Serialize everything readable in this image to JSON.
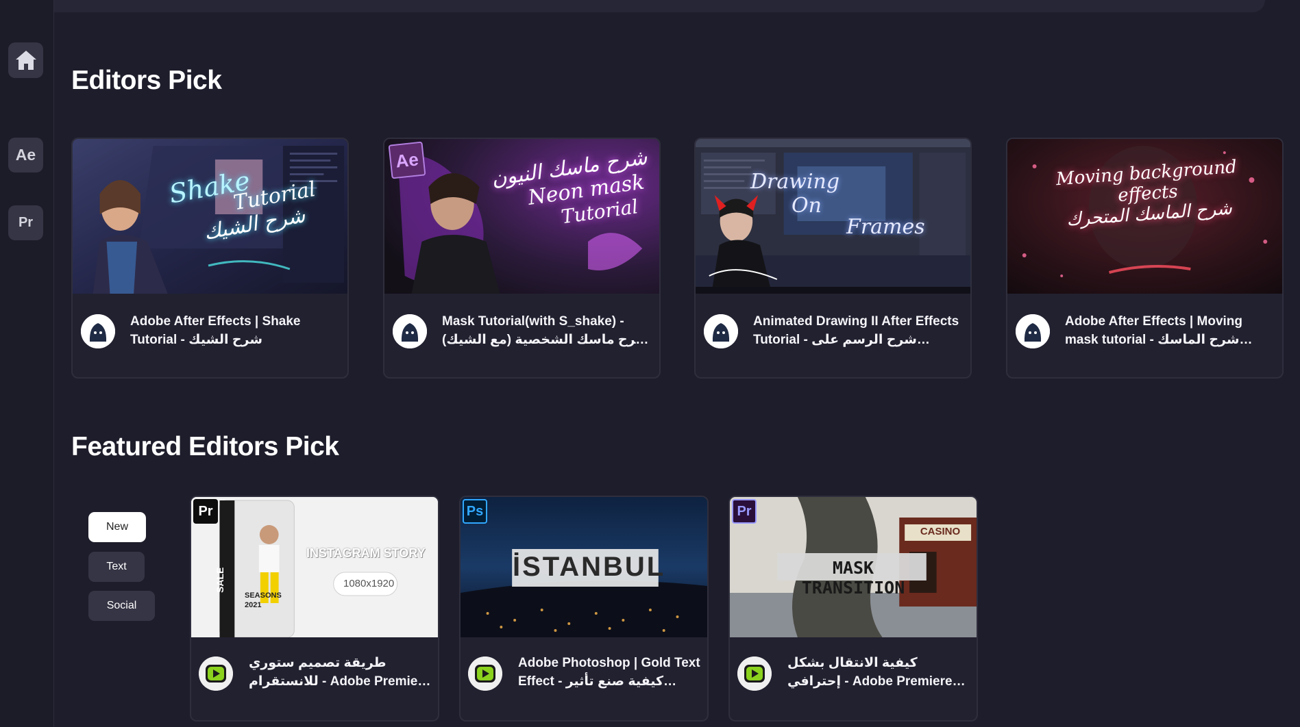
{
  "sidebar": {
    "items": [
      {
        "name": "home",
        "icon": "home-icon"
      },
      {
        "name": "after-effects",
        "label": "Ae"
      },
      {
        "name": "premiere",
        "label": "Pr"
      }
    ]
  },
  "sections": {
    "editors_pick_title": "Editors Pick",
    "featured_title": "Featured Editors Pick"
  },
  "editors_pick": [
    {
      "title": "Adobe After Effects | Shake Tutorial - شرح الشيك",
      "thumb_text": [
        "Shake",
        "Tutorial",
        "شرح الشيك"
      ]
    },
    {
      "title": "Mask Tutorial(with S_shake) - شرح ماسك الشخصية (مع الشيك) !!",
      "thumb_text": [
        "شرح ماسك النيون",
        "Neon mask",
        "Tutorial"
      ],
      "badge": "Ae"
    },
    {
      "title": "Animated Drawing II After Effects Tutorial - شرح الرسم على الفيديو",
      "thumb_text": [
        "Drawing",
        "On",
        "Frames"
      ]
    },
    {
      "title": "Adobe After Effects | Moving mask tutorial - شرح الماسك المتحرك",
      "thumb_text": [
        "Moving background",
        "effects",
        "شرح الماسك المتحرك"
      ]
    }
  ],
  "filters": [
    {
      "label": "New",
      "active": true
    },
    {
      "label": "Text",
      "active": false
    },
    {
      "label": "Social",
      "active": false
    }
  ],
  "featured": [
    {
      "title": "طريقة تصميم ستوري للانستقرام - Adobe Premiere Pro |...",
      "badge": "Pr",
      "thumb_text": [
        "INSTAGRAM STORY",
        "1080x1920",
        "SEASONS",
        "2021",
        "SALE"
      ]
    },
    {
      "title": "Adobe Photoshop | Gold Text Effect - كيفية صنع تأثير الخط...",
      "badge": "Ps",
      "thumb_text": [
        "İSTANBUL"
      ]
    },
    {
      "title": "كيفية الانتقال بشكل إحترافي - Adobe Premiere Pro | Mask...",
      "badge": "Pr",
      "thumb_text": [
        "MASK TRANSITION",
        "CASINO"
      ]
    }
  ],
  "colors": {
    "background": "#1e1d2b",
    "card": "#222130",
    "button": "#363545",
    "premiere_purple": "#9999ff",
    "photoshop_blue": "#31a8ff"
  }
}
